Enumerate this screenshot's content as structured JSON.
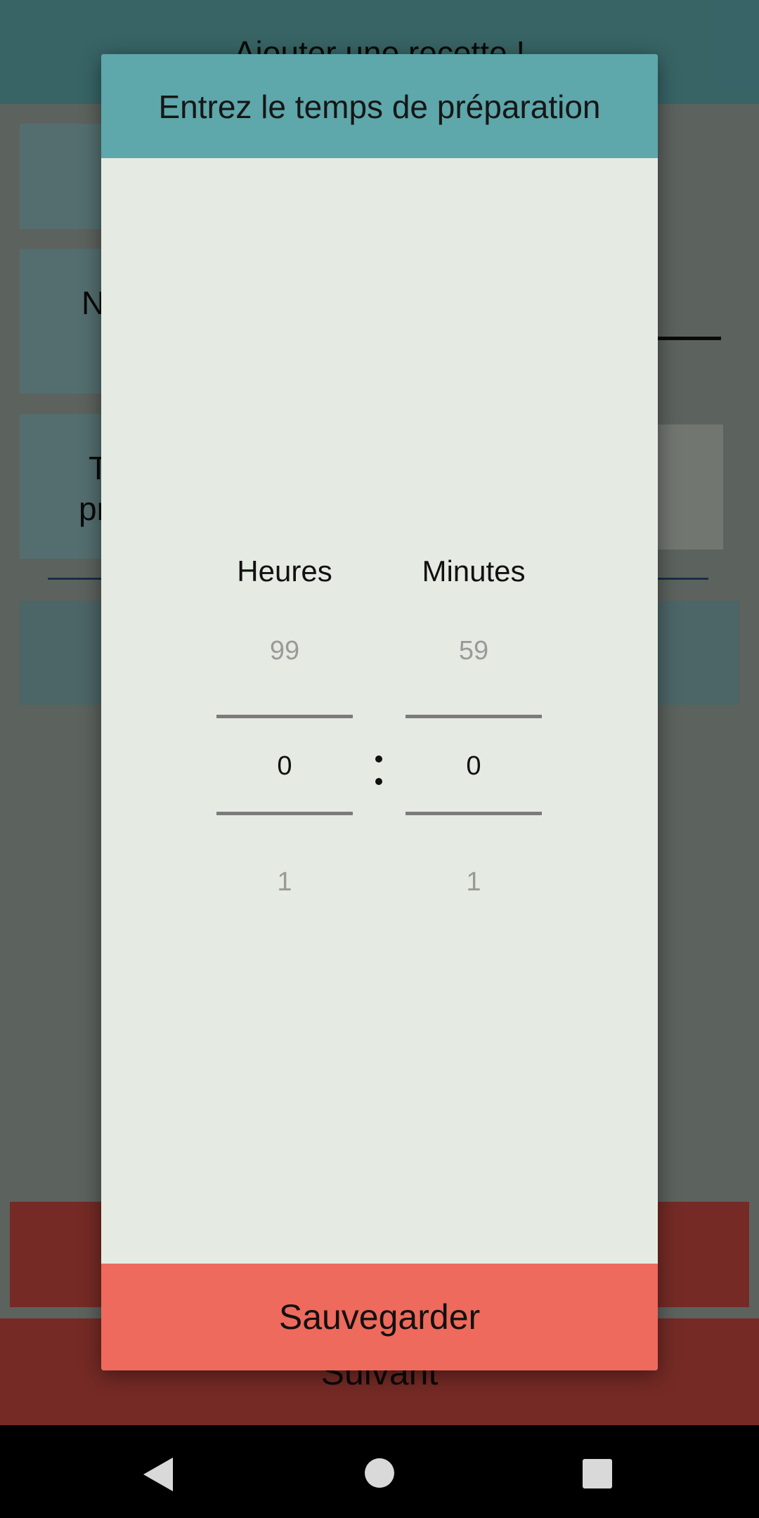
{
  "background": {
    "title": "Ajouter une recette !",
    "name_label": "N",
    "time_label_line1": "T",
    "time_label_line2": "pr",
    "next_button": "Suivant"
  },
  "dialog": {
    "title": "Entrez le temps de préparation",
    "hours": {
      "label": "Heures",
      "prev": "99",
      "selected": "0",
      "next": "1"
    },
    "minutes": {
      "label": "Minutes",
      "prev": "59",
      "selected": "0",
      "next": "1"
    },
    "separator": ":",
    "save_label": "Sauvegarder"
  },
  "colors": {
    "header": "#5ea7ab",
    "dialog_bg": "#e5ebe2",
    "save_button": "#ee6a5c",
    "bg_button": "#c4473f"
  },
  "nav_bar": {
    "icons": [
      "back-icon",
      "home-icon",
      "recents-icon"
    ]
  }
}
